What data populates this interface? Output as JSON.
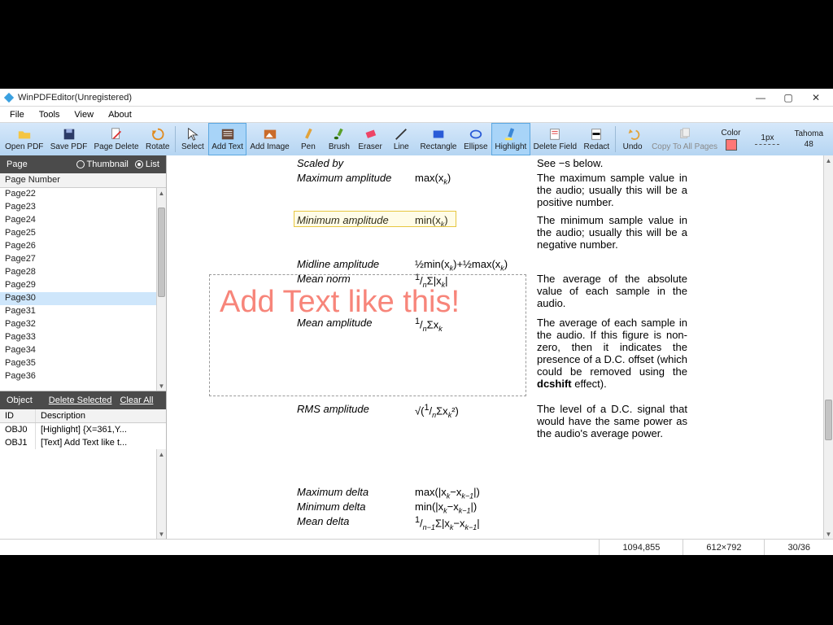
{
  "window": {
    "title": "WinPDFEditor(Unregistered)"
  },
  "menu": {
    "items": [
      "File",
      "Tools",
      "View",
      "About"
    ]
  },
  "toolbar": {
    "open_pdf": "Open PDF",
    "save_pdf": "Save PDF",
    "page_delete": "Page Delete",
    "rotate": "Rotate",
    "select": "Select",
    "add_text": "Add Text",
    "add_image": "Add Image",
    "pen": "Pen",
    "brush": "Brush",
    "eraser": "Eraser",
    "line": "Line",
    "rectangle": "Rectangle",
    "ellipse": "Ellipse",
    "highlight": "Highlight",
    "delete_field": "Delete Field",
    "redact": "Redact",
    "undo": "Undo",
    "copy_all": "Copy To All Pages",
    "color_label": "Color",
    "stroke_label": "1px",
    "font_name": "Tahoma",
    "font_size": "48"
  },
  "sidebar": {
    "page_panel_title": "Page",
    "view_thumbnail": "Thumbnail",
    "view_list": "List",
    "col_header": "Page Number",
    "pages": [
      "Page22",
      "Page23",
      "Page24",
      "Page25",
      "Page26",
      "Page27",
      "Page28",
      "Page29",
      "Page30",
      "Page31",
      "Page32",
      "Page33",
      "Page34",
      "Page35",
      "Page36"
    ],
    "selected_page_index": 8,
    "object_panel_title": "Object",
    "delete_selected": "Delete Selected",
    "clear_all": "Clear All",
    "obj_col_id": "ID",
    "obj_col_desc": "Description",
    "objects": [
      {
        "id": "OBJ0",
        "desc": "[Highlight] {X=361,Y..."
      },
      {
        "id": "OBJ1",
        "desc": "[Text] Add Text like t..."
      }
    ]
  },
  "document": {
    "rows": {
      "scaled_by": {
        "label": "Scaled by",
        "formula": "",
        "desc": "See −s below."
      },
      "max_amp": {
        "label": "Maximum amplitude",
        "formula": "max(x_k)",
        "desc": "The maximum sample value in the audio; usually this will be a positive number."
      },
      "min_amp": {
        "label": "Minimum amplitude",
        "formula": "min(x_k)",
        "desc": "The minimum sample value in the audio; usually this will be a negative number."
      },
      "midline_amp": {
        "label": "Midline amplitude",
        "formula": "½min(x_k)+½max(x_k)",
        "desc": ""
      },
      "mean_norm": {
        "label": "Mean norm",
        "formula": "¹/ₙΣ|x_k|",
        "desc": "The average of the absolute value of each sample in the audio."
      },
      "mean_amp": {
        "label": "Mean amplitude",
        "formula": "¹/ₙΣx_k",
        "desc_html": "The average of each sample in the audio.  If this figure is non-zero, then it indicates the presence of a D.C. offset (which could be removed using the <b>dcshift</b> effect)."
      },
      "rms_amp": {
        "label": "RMS amplitude",
        "formula": "√(¹/ₙΣx_k²)",
        "desc": "The level of a D.C. signal that would have the same power as the audio's average power."
      },
      "max_delta": {
        "label": "Maximum delta",
        "formula": "max(|x_k−x_{k−1}|)",
        "desc": ""
      },
      "min_delta": {
        "label": "Minimum delta",
        "formula": "min(|x_k−x_{k−1}|)",
        "desc": ""
      },
      "mean_delta": {
        "label": "Mean delta",
        "formula": "¹/ₙ₋₁Σ|x_k−x_{k−1}|",
        "desc": ""
      }
    },
    "text_annotation": "Add Text like this!"
  },
  "status": {
    "cursor": "1094,855",
    "page_size": "612×792",
    "page_of": "30/36"
  },
  "colors": {
    "accent": "#a8d4f8",
    "annotation_text": "#f7857a",
    "highlight": "#e6c640"
  }
}
